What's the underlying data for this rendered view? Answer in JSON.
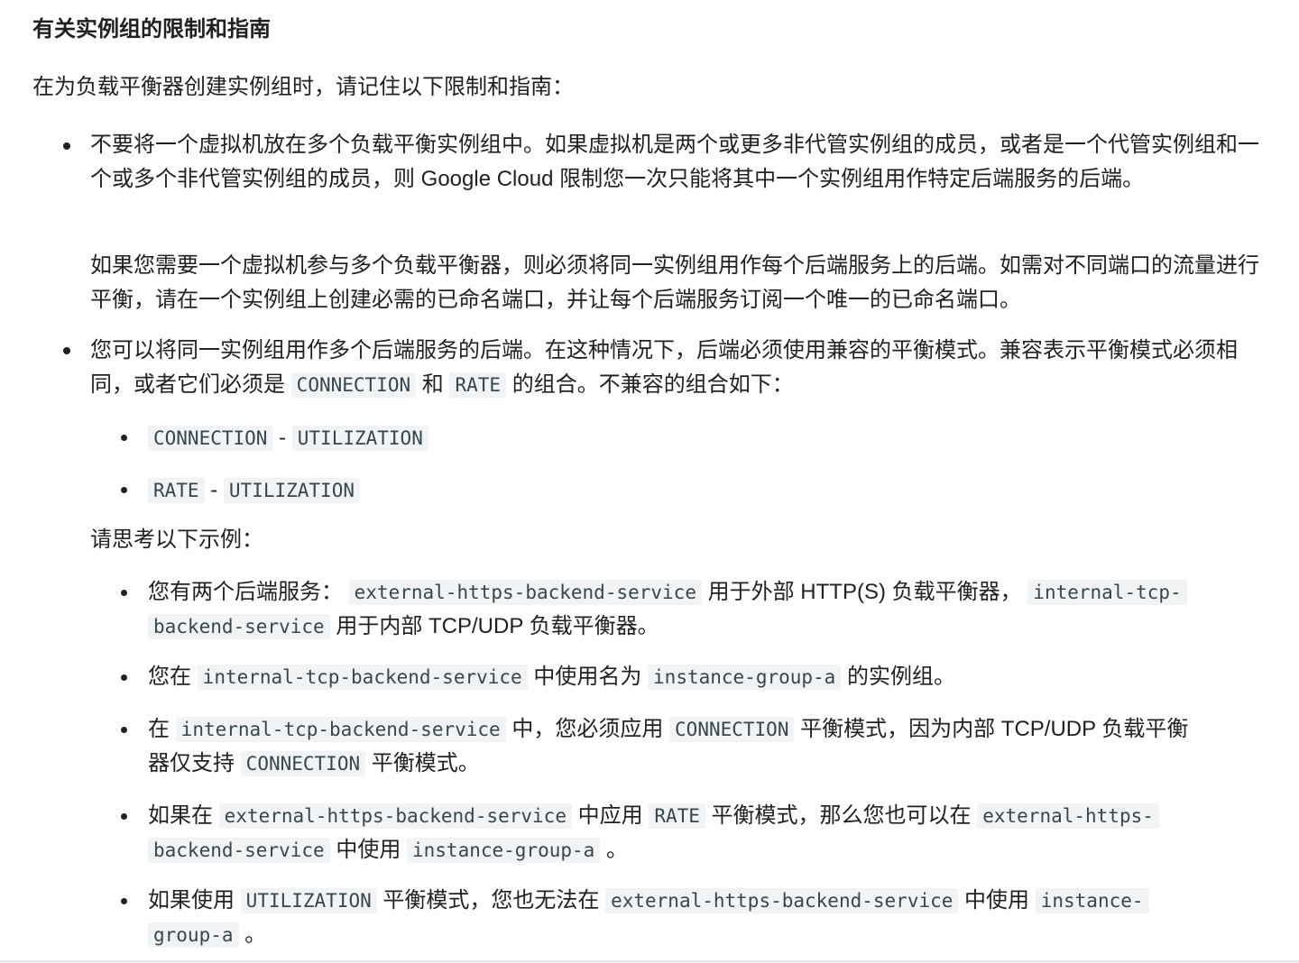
{
  "heading": "有关实例组的限制和指南",
  "intro": "在为负载平衡器创建实例组时，请记住以下限制和指南：",
  "b1": {
    "p1": "不要将一个虚拟机放在多个负载平衡实例组中。如果虚拟机是两个或更多非代管实例组的成员，或者是一个代管实例组和一个或多个非代管实例组的成员，则 Google Cloud 限制您一次只能将其中一个实例组用作特定后端服务的后端。",
    "p2": "如果您需要一个虚拟机参与多个负载平衡器，则必须将同一实例组用作每个后端服务上的后端。如需对不同端口的流量进行平衡，请在一个实例组上创建必需的已命名端口，并让每个后端服务订阅一个唯一的已命名端口。"
  },
  "b2": {
    "t1": "您可以将同一实例组用作多个后端服务的后端。在这种情况下，后端必须使用兼容的平衡模式。兼容表示平衡模式必须相同，或者它们必须是 ",
    "c1": "CONNECTION",
    "t2": " 和 ",
    "c2": "RATE",
    "t3": " 的组合。不兼容的组合如下：",
    "combo1": {
      "a": "CONNECTION",
      "sep": " - ",
      "b": "UTILIZATION"
    },
    "combo2": {
      "a": "RATE",
      "sep": " - ",
      "b": "UTILIZATION"
    },
    "consider": "请思考以下示例：",
    "ex1": {
      "t1": "您有两个后端服务：",
      "c1": "external-https-backend-service",
      "t2": " 用于外部 HTTP(S) 负载平衡器，",
      "c2a": "internal-tcp-",
      "c2b": "backend-service",
      "t3": " 用于内部 TCP/UDP 负载平衡器。"
    },
    "ex2": {
      "t1": "您在 ",
      "c1": "internal-tcp-backend-service",
      "t2": " 中使用名为 ",
      "c2": "instance-group-a",
      "t3": " 的实例组。"
    },
    "ex3": {
      "t1": "在 ",
      "c1": "internal-tcp-backend-service",
      "t2": " 中，您必须应用 ",
      "c2": "CONNECTION",
      "t3": " 平衡模式，因为内部 TCP/UDP 负载平衡",
      "t4": "器仅支持 ",
      "c3": "CONNECTION",
      "t5": " 平衡模式。"
    },
    "ex4": {
      "t1": "如果在 ",
      "c1": "external-https-backend-service",
      "t2": " 中应用 ",
      "c2": "RATE",
      "t3": " 平衡模式，那么您也可以在 ",
      "c3a": "external-https-",
      "c3b": "backend-service",
      "t4": " 中使用 ",
      "c4": "instance-group-a",
      "t5": " 。"
    },
    "ex5": {
      "t1": "如果使用 ",
      "c1": "UTILIZATION",
      "t2": " 平衡模式，您也无法在 ",
      "c2": "external-https-backend-service",
      "t3": " 中使用 ",
      "c3a": "instance-",
      "c3b": "group-a",
      "t4": " 。"
    }
  }
}
